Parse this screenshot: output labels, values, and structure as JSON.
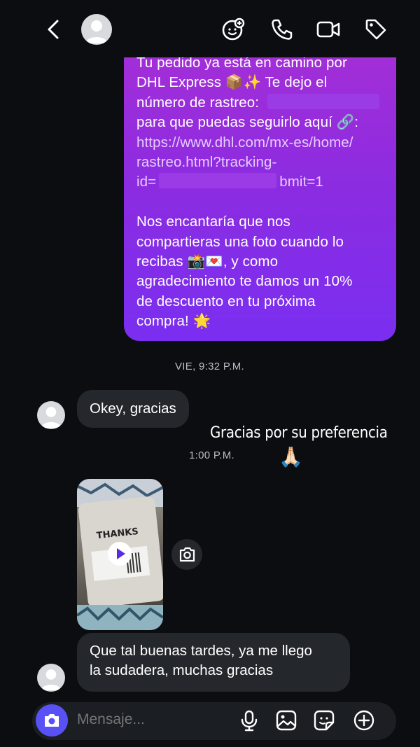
{
  "header": {
    "back_icon": "chevron-left-icon",
    "icons": [
      "sticker-add-icon",
      "phone-icon",
      "video-camera-icon",
      "tag-icon"
    ]
  },
  "outgoing_message": {
    "lines": [
      "Tu pedido ya está en camino por",
      "DHL Express 📦✨ Te dejo el",
      "número de rastreo:",
      "para que puedas seguirlo aquí 🔗:",
      "https://www.dhl.com/mx-es/home/",
      "rastreo.html?tracking-",
      "id=",
      "bmit=1",
      "Nos encantaría que nos",
      "compartieras una foto cuando lo",
      "recibas 📸💌, y como",
      "agradecimiento te damos un 10%",
      "de descuento en tu próxima",
      "compra! 🌟"
    ]
  },
  "timestamps": {
    "first": "VIE, 9:32 P.M.",
    "second": "1:00 P.M."
  },
  "incoming_1": {
    "text": "Okey, gracias"
  },
  "sticker": {
    "text": "Gracias por su preferencia",
    "emoji": "🙏🏻"
  },
  "video": {
    "play_icon": "play-icon",
    "camera_icon": "camera-icon"
  },
  "incoming_2": {
    "line1": "Que tal buenas tardes, ya me llego",
    "line2": "la sudadera, muchas gracias"
  },
  "composer": {
    "placeholder": "Mensaje...",
    "icons": [
      "camera-icon",
      "microphone-icon",
      "gallery-icon",
      "sticker-icon",
      "plus-circle-icon"
    ]
  },
  "colors": {
    "background": "#0b0d10",
    "bubble_out_top": "#a52ed6",
    "bubble_out_bottom": "#7a2ef0",
    "bubble_in": "#24272c",
    "camera_button": "#5851f5"
  }
}
